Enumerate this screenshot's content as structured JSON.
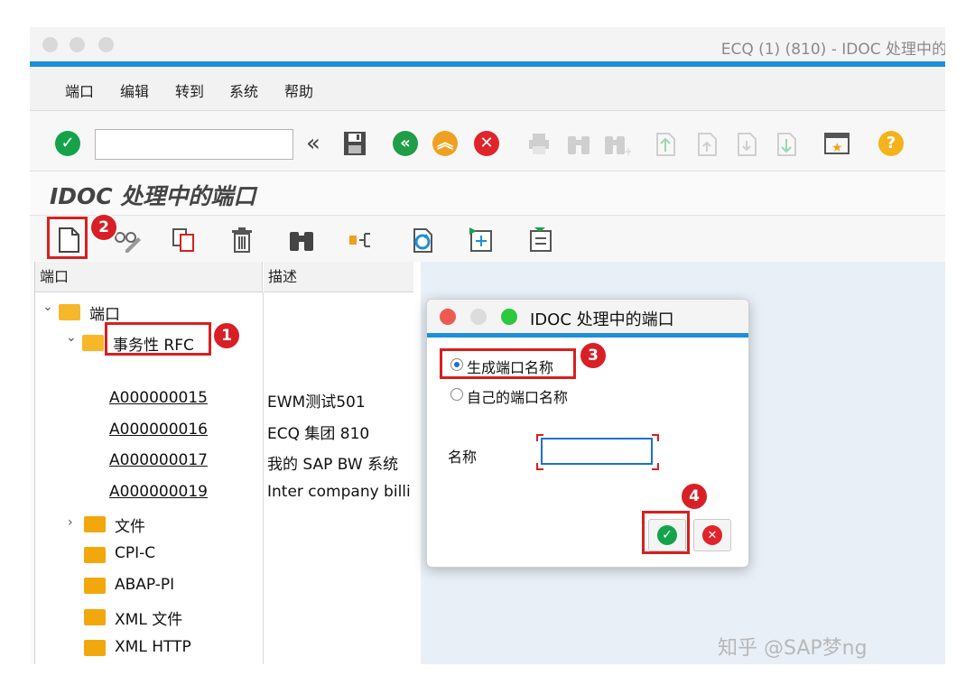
{
  "window": {
    "title": "ECQ (1) (810) - IDOC 处理中的"
  },
  "menu": {
    "items": [
      "端口",
      "编辑",
      "转到",
      "系统",
      "帮助"
    ]
  },
  "toolbar": {
    "command_value": "",
    "history_glyph": "«"
  },
  "page": {
    "title": "IDOC 处理中的端口"
  },
  "table": {
    "headers": [
      "端口",
      "描述"
    ],
    "root": "端口",
    "group": "事务性 RFC",
    "rows": [
      {
        "port": "A000000015",
        "desc": "EWM测试501"
      },
      {
        "port": "A000000016",
        "desc": "ECQ 集团 810"
      },
      {
        "port": "A000000017",
        "desc": "我的 SAP BW 系统"
      },
      {
        "port": "A000000019",
        "desc": "Inter company billi"
      }
    ],
    "folders": [
      "文件",
      "CPI-C",
      "ABAP-PI",
      "XML 文件",
      "XML HTTP"
    ]
  },
  "dialog": {
    "title": "IDOC 处理中的端口",
    "option_generate": "生成端口名称",
    "option_own": "自己的端口名称",
    "name_label": "名称",
    "name_value": "",
    "confirm_glyph": "✓",
    "cancel_glyph": "✕"
  },
  "annotations": [
    "1",
    "2",
    "3",
    "4"
  ],
  "watermark": "知乎 @SAP梦ng",
  "colors": {
    "accent": "#1e8fd8",
    "ok": "#14a34a",
    "cancel": "#e0242a",
    "back": "#1f9d47",
    "up": "#f0a020",
    "help": "#f5b21b",
    "annotation": "#d91f26",
    "folder": "#f2a80c"
  }
}
